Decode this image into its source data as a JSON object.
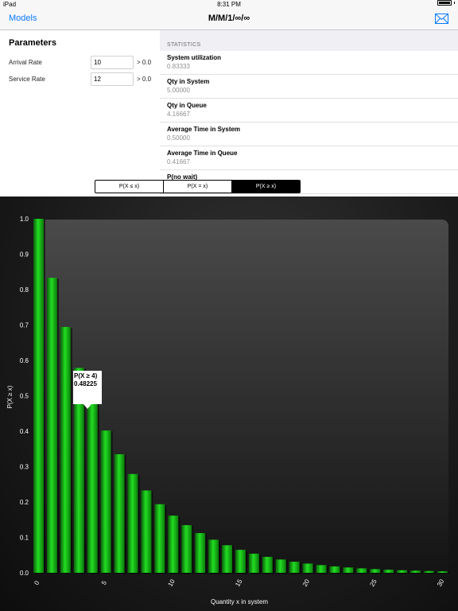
{
  "status_bar": {
    "device": "iPad",
    "time": "8:31 PM"
  },
  "nav": {
    "back_label": "Models",
    "title": "M/M/1/∞/∞"
  },
  "parameters": {
    "title": "Parameters",
    "arrival_rate": {
      "label": "Arrival Rate",
      "value": "10",
      "min": "> 0.0"
    },
    "service_rate": {
      "label": "Service Rate",
      "value": "12",
      "min": "> 0.0"
    }
  },
  "statistics": {
    "header": "STATISTICS",
    "items": [
      {
        "label": "System utilization",
        "value": "0.83333"
      },
      {
        "label": "Qty in System",
        "value": "5.00000"
      },
      {
        "label": "Qty in Queue",
        "value": "4.16667"
      },
      {
        "label": "Average Time in System",
        "value": "0.50000"
      },
      {
        "label": "Average Time in Queue",
        "value": "0.41667"
      },
      {
        "label": "P(no wait)",
        "value": ""
      }
    ]
  },
  "segments": {
    "items": [
      "P(X ≤ x)",
      "P(X = x)",
      "P(X ≥ x)"
    ],
    "selected": 2
  },
  "tooltip": {
    "label": "P(X ≥ 4)",
    "value": "0.48225"
  },
  "chart_data": {
    "type": "bar",
    "xlabel": "Quantity x in system",
    "ylabel": "P(X ≥ x)",
    "xlim": [
      0,
      30
    ],
    "ylim": [
      0,
      1.0
    ],
    "x_ticks": [
      0,
      5,
      10,
      15,
      20,
      25,
      30
    ],
    "y_ticks": [
      "0.0",
      "0.1",
      "0.2",
      "0.3",
      "0.4",
      "0.5",
      "0.6",
      "0.7",
      "0.8",
      "0.9",
      "1.0"
    ],
    "bar_color": "#1fd11f",
    "categories": [
      0,
      1,
      2,
      3,
      4,
      5,
      6,
      7,
      8,
      9,
      10,
      11,
      12,
      13,
      14,
      15,
      16,
      17,
      18,
      19,
      20,
      21,
      22,
      23,
      24,
      25,
      26,
      27,
      28,
      29,
      30
    ],
    "values": [
      1.0,
      0.83333,
      0.69444,
      0.5787,
      0.48225,
      0.40188,
      0.3349,
      0.27908,
      0.23257,
      0.19381,
      0.16151,
      0.13459,
      0.11216,
      0.09346,
      0.07789,
      0.06491,
      0.05409,
      0.04507,
      0.03756,
      0.0313,
      0.02608,
      0.02174,
      0.01811,
      0.01509,
      0.01258,
      0.01048,
      0.00874,
      0.00728,
      0.00607,
      0.00506,
      0.00421
    ]
  }
}
